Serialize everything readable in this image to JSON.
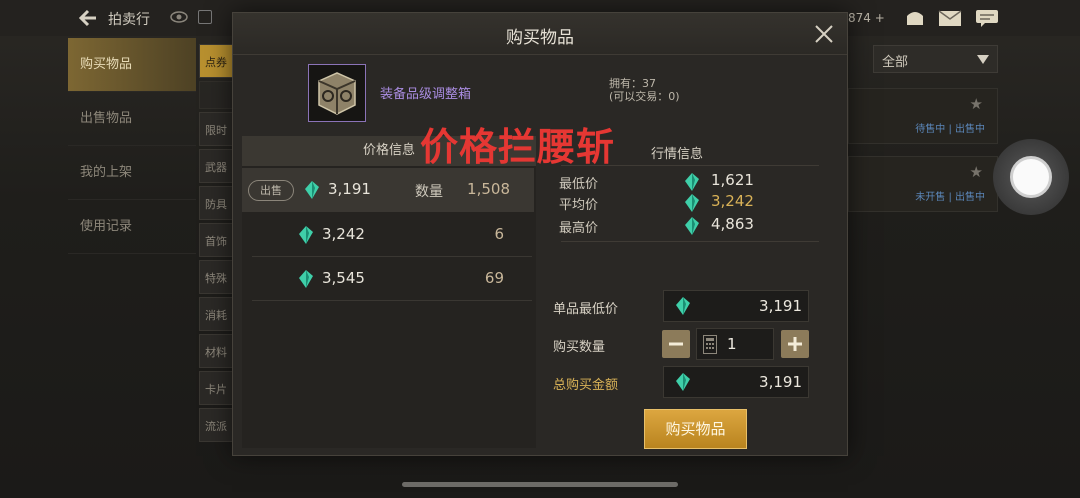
{
  "background": {
    "top_title": "拍卖行",
    "top_count": "874 +",
    "side_menu": [
      {
        "label": "购买物品",
        "active": true
      },
      {
        "label": "出售物品",
        "active": false
      },
      {
        "label": "我的上架",
        "active": false
      },
      {
        "label": "使用记录",
        "active": false
      }
    ],
    "categories": [
      "点券",
      "限时",
      "武器",
      "防具",
      "首饰",
      "特殊",
      "消耗",
      "材料",
      "卡片",
      "流派"
    ],
    "filter_value": "全部",
    "rows": [
      {
        "status": "待售中 | 出售中"
      },
      {
        "status": "未开售 | 出售中"
      }
    ]
  },
  "modal": {
    "title": "购买物品",
    "item_name": "装备品级调整箱",
    "owned_line": "拥有：37",
    "tradable_line": "(可以交易：0)",
    "price_header": "价格信息",
    "sell_tag": "出售",
    "qty_label": "数量",
    "price_rows": [
      {
        "price": "3,191",
        "qty": "1,508"
      },
      {
        "price": "3,242",
        "qty": "6"
      },
      {
        "price": "3,545",
        "qty": "69"
      }
    ],
    "market_header": "行情信息",
    "market": [
      {
        "label": "最低价",
        "value": "1,621"
      },
      {
        "label": "平均价",
        "value": "3,242"
      },
      {
        "label": "最高价",
        "value": "4,863"
      }
    ],
    "unit_min_label": "单品最低价",
    "unit_min_value": "3,191",
    "buy_qty_label": "购买数量",
    "buy_qty_value": "1",
    "total_label": "总购买金额",
    "total_value": "3,191",
    "buy_button": "购买物品"
  },
  "overlay": {
    "text": "价格拦腰斩"
  },
  "colors": {
    "accent_gold": "#d9b257",
    "gem": "#3fcfa9",
    "overlay_red": "#e53733",
    "item_name": "#a98ce0"
  }
}
